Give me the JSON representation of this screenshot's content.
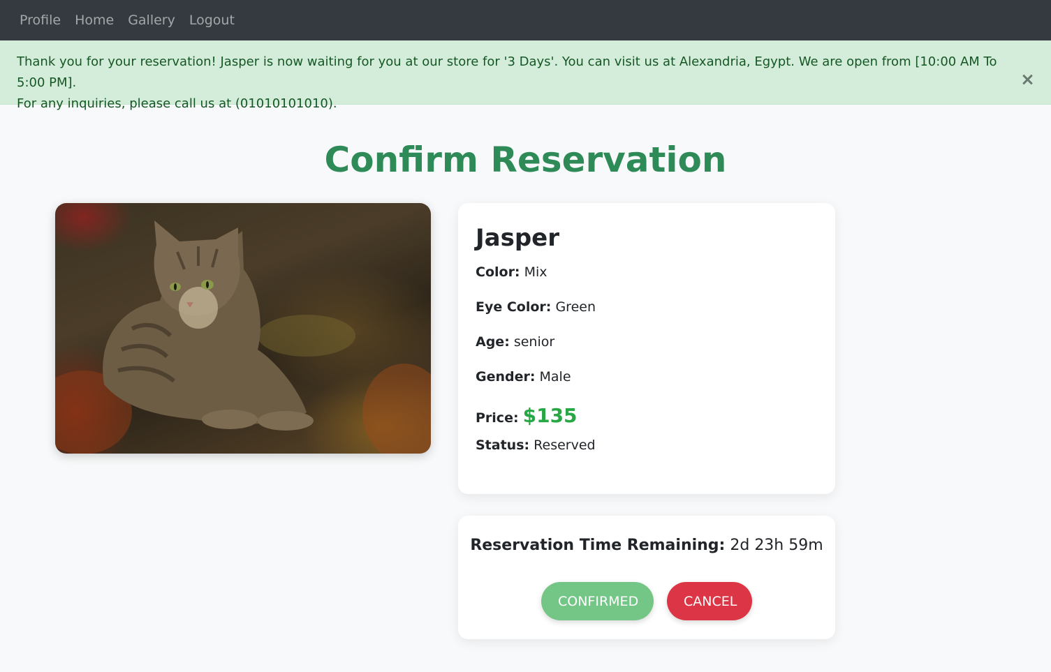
{
  "nav": {
    "items": [
      {
        "label": "Profile"
      },
      {
        "label": "Home"
      },
      {
        "label": "Gallery"
      },
      {
        "label": "Logout"
      }
    ]
  },
  "alert": {
    "line1": "Thank you for your reservation! Jasper is now waiting for you at our store for '3 Days'. You can visit us at Alexandria, Egypt. We are open from [10:00 AM To 5:00 PM].",
    "line2": "For any inquiries, please call us at (01010101010).",
    "close_icon": "close-icon"
  },
  "page": {
    "title": "Confirm Reservation"
  },
  "pet": {
    "name": "Jasper",
    "image_icon": "cat-photo",
    "fields": {
      "color_label": "Color:",
      "color_value": "Mix",
      "eye_label": "Eye Color:",
      "eye_value": "Green",
      "age_label": "Age:",
      "age_value": "senior",
      "gender_label": "Gender:",
      "gender_value": "Male",
      "price_label": "Price:",
      "price_value": "$135",
      "status_label": "Status:",
      "status_value": "Reserved"
    }
  },
  "reservation": {
    "remaining_label": "Reservation Time Remaining:",
    "remaining_value": "2d 23h 59m",
    "confirmed_label": "CONFIRMED",
    "cancel_label": "CANCEL"
  },
  "colors": {
    "navbar": "#343a40",
    "alert_bg": "#d4edda",
    "alert_text": "#155724",
    "title": "#2e8b57",
    "price": "#28a745",
    "confirmed": "#74c687",
    "cancel": "#dc3545"
  }
}
